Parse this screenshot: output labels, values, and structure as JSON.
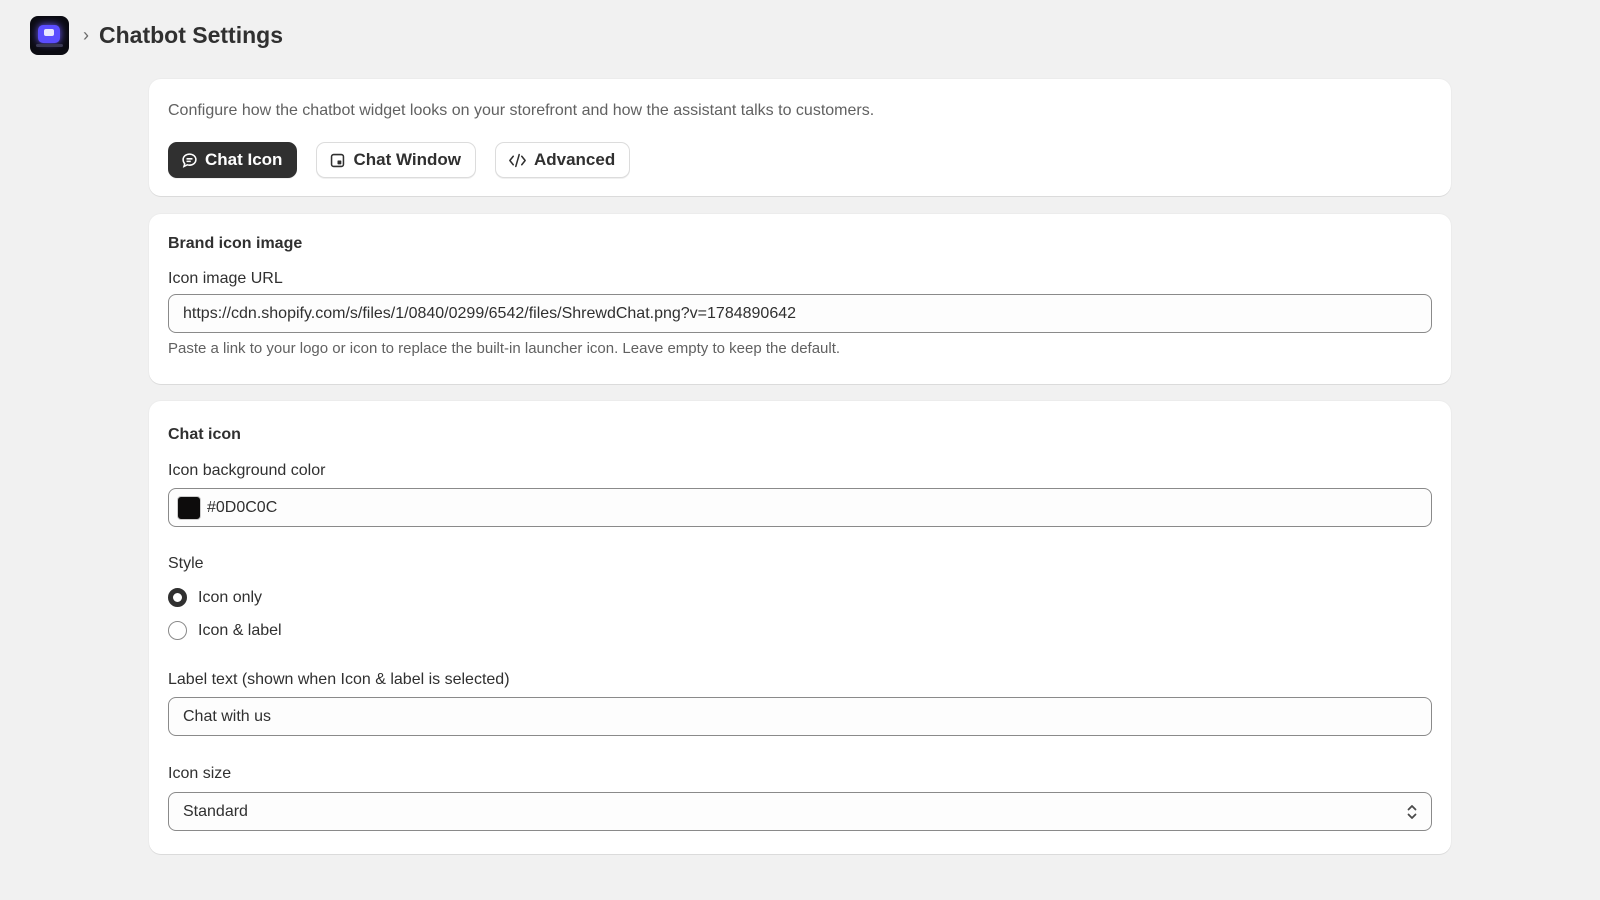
{
  "header": {
    "breadcrumb_sep": "›",
    "title": "Chatbot Settings"
  },
  "intro": {
    "description": "Configure how the chatbot widget looks on your storefront and how the assistant talks to customers.",
    "tabs": [
      {
        "label": "Chat Icon",
        "icon": "chat-bubble-icon",
        "active": true
      },
      {
        "label": "Chat Window",
        "icon": "window-icon",
        "active": false
      },
      {
        "label": "Advanced",
        "icon": "code-icon",
        "active": false
      }
    ]
  },
  "brand": {
    "section_title": "Brand icon image",
    "url_label": "Icon image URL",
    "url_value": "https://cdn.shopify.com/s/files/1/0840/0299/6542/files/ShrewdChat.png?v=1784890642",
    "help": "Paste a link to your logo or icon to replace the built-in launcher icon. Leave empty to keep the default."
  },
  "chat_icon": {
    "section_title": "Chat icon",
    "bg_label": "Icon background color",
    "bg_value": "#0D0C0C",
    "swatch_color": "#0D0C0C",
    "style_label": "Style",
    "style_options": [
      {
        "label": "Icon only",
        "checked": true
      },
      {
        "label": "Icon & label",
        "checked": false
      }
    ],
    "label_text_label": "Label text (shown when Icon & label is selected)",
    "label_text_value": "Chat with us",
    "size_label": "Icon size",
    "size_value": "Standard"
  }
}
